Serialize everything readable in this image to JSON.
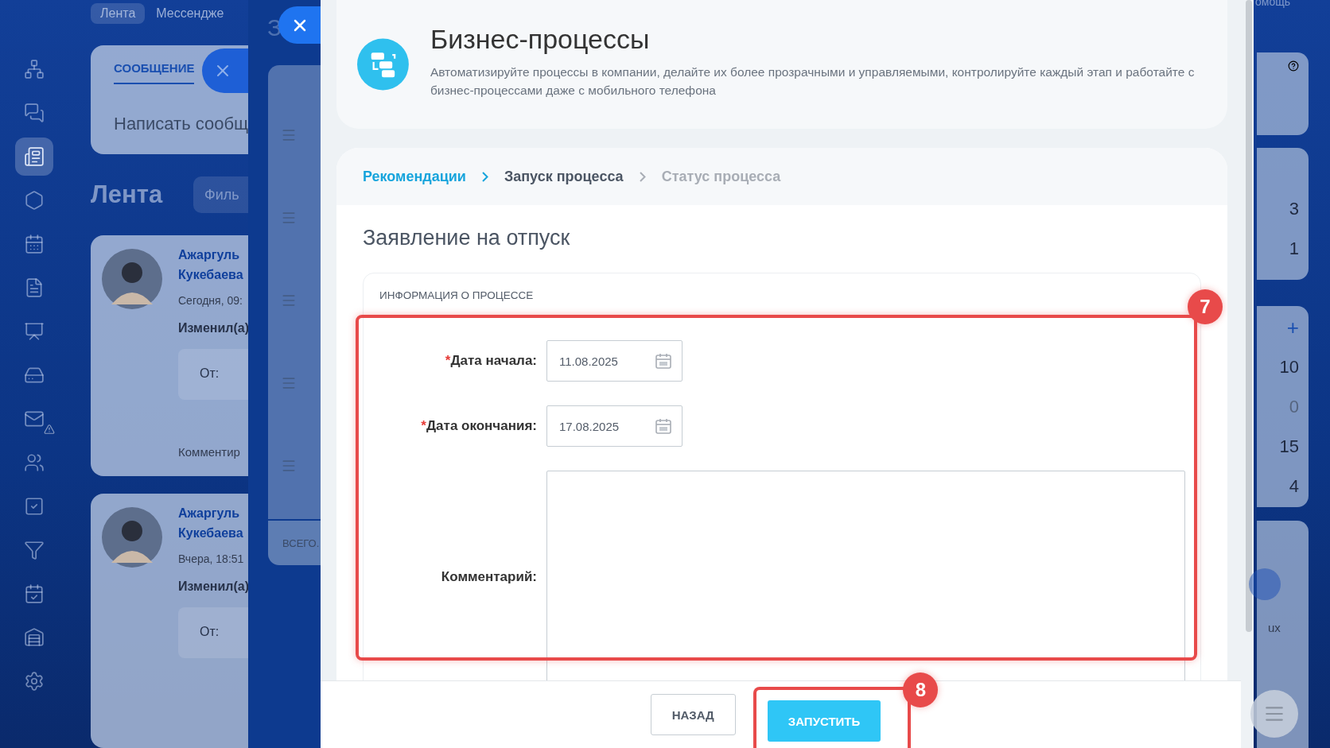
{
  "sidebar": {
    "items": [
      {
        "selected": false
      },
      {
        "selected": false
      },
      {
        "selected": true
      },
      {
        "selected": false
      },
      {
        "selected": false
      },
      {
        "selected": false
      },
      {
        "selected": false
      },
      {
        "selected": false
      },
      {
        "selected": false,
        "warning": true
      },
      {
        "selected": false
      },
      {
        "selected": false
      },
      {
        "selected": false
      },
      {
        "selected": false
      },
      {
        "selected": false
      },
      {
        "selected": false
      }
    ]
  },
  "top_tabs": [
    {
      "label": "Лента",
      "selected": true
    },
    {
      "label": "Мессендже",
      "selected": false
    }
  ],
  "composer": {
    "tab": "СООБЩЕНИЕ",
    "placeholder": "Написать сообщ"
  },
  "feed": {
    "title": "Лента",
    "filter": "Филь"
  },
  "posts": [
    {
      "author": "Ажаргуль Кукебаева",
      "time": "Сегодня, 09:",
      "action": "Изменил(а)",
      "from": "От:",
      "comment": "Комментир"
    },
    {
      "author": "Ажаргуль Кукебаева",
      "time": "Вчера, 18:51",
      "action": "Изменил(а)",
      "from": "От:"
    }
  ],
  "back_panel": {
    "title": "З",
    "footer": "ВСЕГО."
  },
  "modal": {
    "title": "Бизнес-процессы",
    "description": "Автоматизируйте процессы в компании, делайте их более прозрачными и управляемыми, контролируйте каждый этап и работайте с бизнес-процессами даже с мобильного телефона",
    "steps": [
      {
        "label": "Рекомендации",
        "done": true,
        "selected": false
      },
      {
        "label": "Запуск процесса",
        "done": false,
        "selected": true
      },
      {
        "label": "Статус процесса",
        "done": false,
        "selected": false
      }
    ],
    "form_title": "Заявление на отпуск",
    "section": "ИНФОРМАЦИЯ О ПРОЦЕССЕ",
    "fields": [
      {
        "kind": "date",
        "label": "Дата начала:",
        "required_mark": "*",
        "value": "11.08.2025"
      },
      {
        "kind": "date",
        "label": "Дата окончания:",
        "required_mark": "*",
        "value": "17.08.2025"
      },
      {
        "kind": "text",
        "label": "Комментарий:"
      }
    ],
    "buttons": [
      {
        "label": "НАЗАД",
        "kind": "secondary"
      },
      {
        "label": "ЗАПУСТИТЬ",
        "kind": "primary"
      }
    ],
    "callouts": [
      "7",
      "8"
    ]
  },
  "right_column": {
    "help": "омощь",
    "counts_a": [
      {
        "value": "3",
        "muted": false
      },
      {
        "value": "1",
        "muted": false
      }
    ],
    "plus": "+",
    "counts_b": [
      {
        "value": "10",
        "muted": false
      },
      {
        "value": "0",
        "muted": true
      },
      {
        "value": "15",
        "muted": false
      },
      {
        "value": "4",
        "muted": false
      }
    ],
    "app_label": "ux"
  }
}
